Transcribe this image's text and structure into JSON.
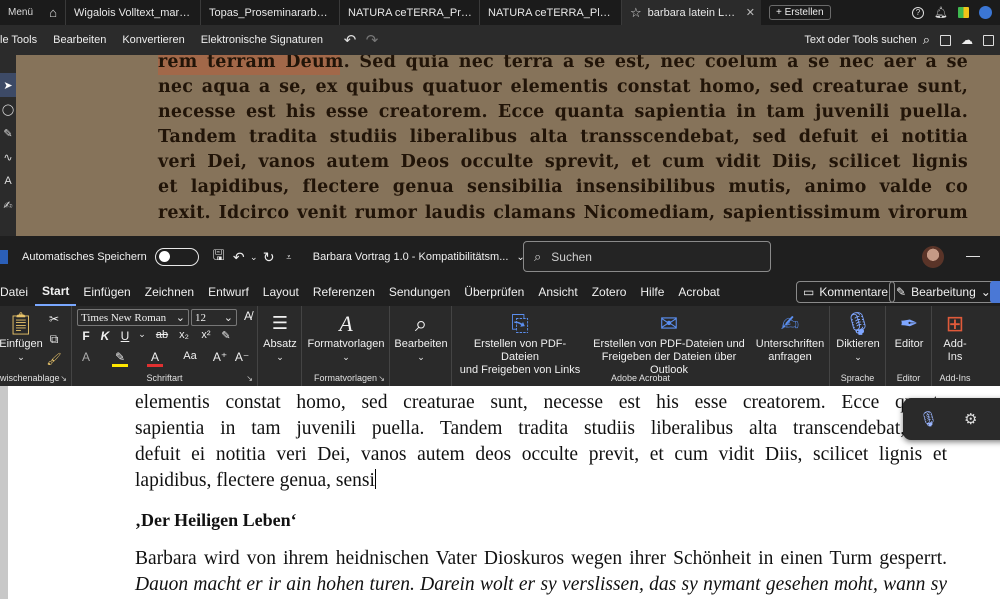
{
  "acrobat": {
    "menu": "Menü",
    "tabs": [
      {
        "label": "Wigalois Volltext_markup.pdf"
      },
      {
        "label": "Topas_Proseminararbeit_Ki..."
      },
      {
        "label": "NATURA ceTERRA_Progra..."
      },
      {
        "label": "NATURA ceTERRA_Plakat ..."
      },
      {
        "label": "barbara latein LA.pdf"
      }
    ],
    "new_tab": "+ Erstellen",
    "toolbar": [
      "le Tools",
      "Bearbeiten",
      "Konvertieren",
      "Elektronische Signaturen"
    ],
    "search_label": "Text oder Tools suchen",
    "scan_lines": [
      "rem terram Deum. Sed quia nec terra a se est, nec coelum a se nec aer a se",
      "nec aqua a se, ex quibus quatuor elementis constat homo, sed creaturae sunt,",
      "necesse est his esse creatorem. Ecce quanta sapientia in tam juvenili puella.",
      "Tandem tradita studiis liberalibus alta transscendebat, sed defuit ei notitia",
      "veri Dei, vanos autem Deos occulte sprevit, et cum vidit Diis, scilicet lignis",
      "et lapidibus, flectere genua sensibilia insensibilibus mutis, animo valde co",
      "rexit. Idcirco venit rumor laudis clamans Nicomediam, sapientissimum virorum"
    ]
  },
  "word": {
    "autosave_label": "Automatisches Speichern",
    "doc_title": "Barbara Vortrag 1.0  -  Kompatibilitätsm...",
    "search_placeholder": "Suchen",
    "tabs": [
      "Datei",
      "Start",
      "Einfügen",
      "Zeichnen",
      "Entwurf",
      "Layout",
      "Referenzen",
      "Sendungen",
      "Überprüfen",
      "Ansicht",
      "Zotero",
      "Hilfe",
      "Acrobat"
    ],
    "active_tab": "Start",
    "comments_button": "Kommentare",
    "editing_button": "Bearbeitung",
    "ribbon": {
      "paste_label": "Einfügen",
      "clipboard_group": "wischenablage",
      "font_name": "Times New Roman",
      "font_size": "12",
      "font_group": "Schriftart",
      "paragraph_label": "Absatz",
      "styles_label": "Formatvorlagen",
      "styles_group": "Formatvorlagen",
      "edit_label": "Bearbeiten",
      "pdf_links_label": [
        "Erstellen von PDF-Dateien",
        "und Freigeben von Links"
      ],
      "pdf_outlook_label": [
        "Erstellen von PDF-Dateien und",
        "Freigeben der Dateien über Outlook"
      ],
      "signatures_label": [
        "Unterschriften",
        "anfragen"
      ],
      "acrobat_group": "Adobe Acrobat",
      "dictate_label": "Diktieren",
      "voice_group": "Sprache",
      "editor_label": "Editor",
      "editor_group": "Editor",
      "addins_label": [
        "Add-",
        "Ins"
      ],
      "addins_group": "Add-Ins"
    },
    "document": {
      "para1_lines": [
        "elementis constat homo, sed creaturae sunt, necesse est his esse creatorem. Ecce quanta",
        "sapientia in tam juvenili puella. Tandem tradita studiis liberalibus alta transcendebat, sed",
        "defuit ei notitia veri Dei, vanos autem deos occulte previt, et cum vidit Diis, scilicet lignis et"
      ],
      "para1_last": "lapidibus, flectere genua, sensi",
      "heading": "‚Der Heiligen Leben‘",
      "para2_line1": "Barbara wird von ihrem heidnischen Vater Dioskuros wegen ihrer Schönheit in einen Turm gesperrt.",
      "para2_line2": "Dauon macht er ir ain hohen turen. Darein wolt er sy verslissen, das sy nymant gesehen moht, wann sy"
    }
  }
}
